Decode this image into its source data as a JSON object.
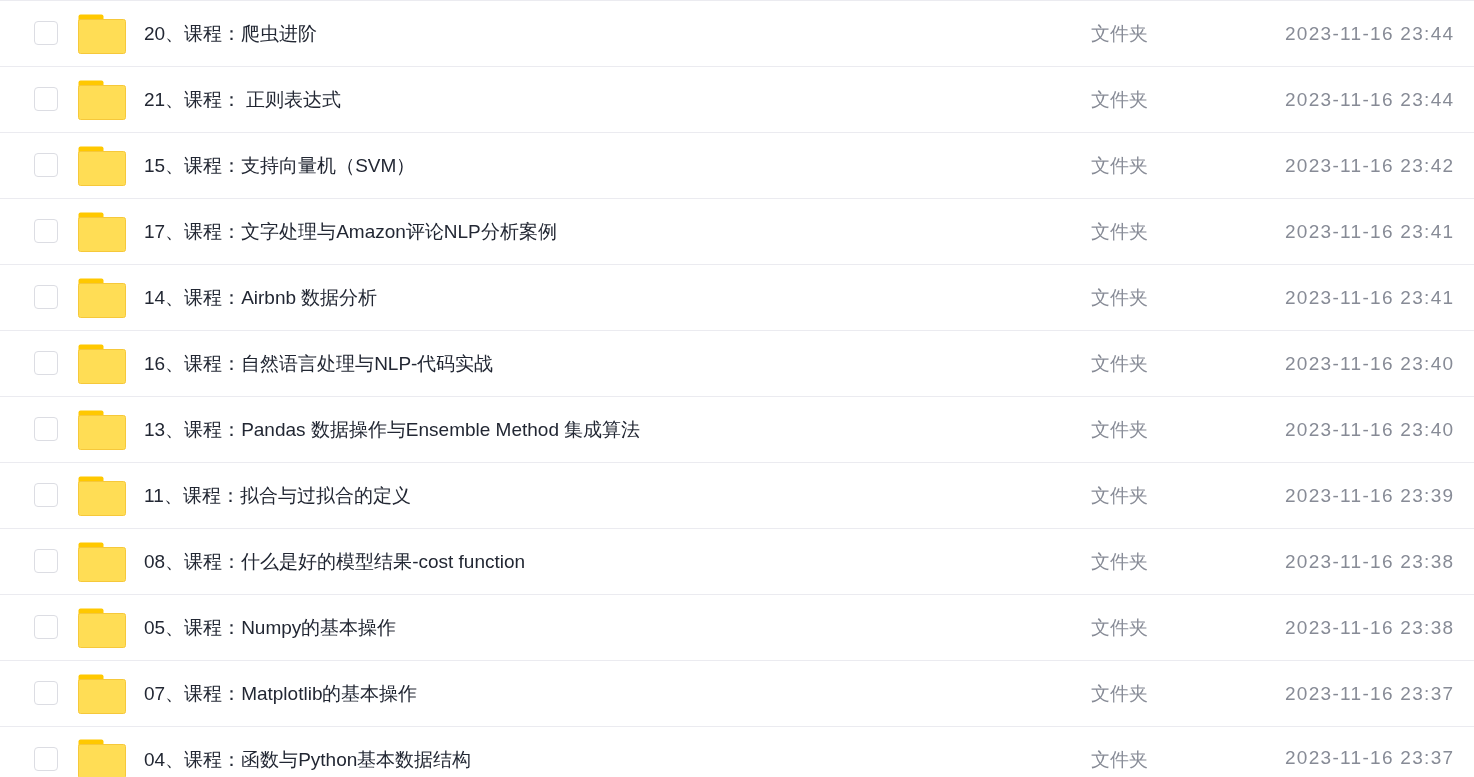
{
  "files": [
    {
      "name": "20、课程：爬虫进阶",
      "type": "文件夹",
      "modified": "2023-11-16 23:44",
      "checked": false
    },
    {
      "name": "21、课程： 正则表达式",
      "type": "文件夹",
      "modified": "2023-11-16 23:44",
      "checked": false
    },
    {
      "name": "15、课程：支持向量机（SVM）",
      "type": "文件夹",
      "modified": "2023-11-16 23:42",
      "checked": false
    },
    {
      "name": "17、课程：文字处理与Amazon评论NLP分析案例",
      "type": "文件夹",
      "modified": "2023-11-16 23:41",
      "checked": false
    },
    {
      "name": "14、课程：Airbnb 数据分析",
      "type": "文件夹",
      "modified": "2023-11-16 23:41",
      "checked": false
    },
    {
      "name": "16、课程：自然语言处理与NLP-代码实战",
      "type": "文件夹",
      "modified": "2023-11-16 23:40",
      "checked": false
    },
    {
      "name": "13、课程：Pandas 数据操作与Ensemble Method 集成算法",
      "type": "文件夹",
      "modified": "2023-11-16 23:40",
      "checked": false
    },
    {
      "name": "11、课程：拟合与过拟合的定义",
      "type": "文件夹",
      "modified": "2023-11-16 23:39",
      "checked": false
    },
    {
      "name": "08、课程：什么是好的模型结果-cost function",
      "type": "文件夹",
      "modified": "2023-11-16 23:38",
      "checked": false
    },
    {
      "name": "05、课程：Numpy的基本操作",
      "type": "文件夹",
      "modified": "2023-11-16 23:38",
      "checked": false
    },
    {
      "name": "07、课程：Matplotlib的基本操作",
      "type": "文件夹",
      "modified": "2023-11-16 23:37",
      "checked": false
    },
    {
      "name": "04、课程：函数与Python基本数据结构",
      "type": "文件夹",
      "modified": "2023-11-16 23:37",
      "checked": false
    }
  ]
}
